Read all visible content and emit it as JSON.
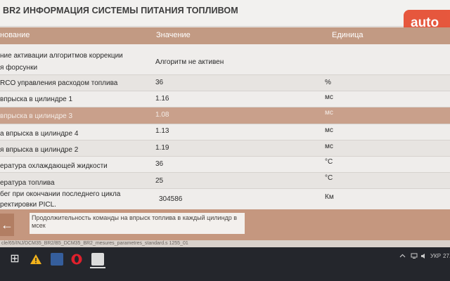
{
  "window": {
    "title": "BR2 ИНФОРМАЦИЯ СИСТЕМЫ ПИТАНИЯ ТОПЛИВОМ",
    "watermark": "auto"
  },
  "table": {
    "headers": {
      "name": "нование",
      "value": "Значение",
      "unit": "Единица"
    },
    "rows": [
      {
        "name_lines": [
          "ние активации алгоритмов коррекции",
          "я форсунки"
        ],
        "value": "Алгоритм не активен",
        "unit": ""
      },
      {
        "name_lines": [
          "RCO управления расходом топлива"
        ],
        "value": "36",
        "unit": "%"
      },
      {
        "name_lines": [
          "впрыска в цилиндре 1"
        ],
        "value": "1.16",
        "unit": "мс"
      },
      {
        "name_lines": [
          "впрыска в цилиндре 3"
        ],
        "value": "1.08",
        "unit": "мс"
      },
      {
        "name_lines": [
          "а впрыска в цилиндре 4"
        ],
        "value": "1.13",
        "unit": "мс"
      },
      {
        "name_lines": [
          "я впрыска в цилиндре 2"
        ],
        "value": "1.19",
        "unit": "мс"
      },
      {
        "name_lines": [
          "ература охлаждающей жидкости"
        ],
        "value": "36",
        "unit": "°C"
      },
      {
        "name_lines": [
          "ература топлива"
        ],
        "value": "25",
        "unit": "°C"
      },
      {
        "name_lines": [
          "бег при окончании последнего цикла",
          "ректировки PICL."
        ],
        "value": "304586",
        "unit": "Км"
      }
    ]
  },
  "info": {
    "back_icon": "←",
    "text": "Продолжительность команды на впрыск топлива в каждый цилиндр в мсек"
  },
  "status": {
    "path": "cle/65/INJ/DCM35_BR2/B5_DCM35_BR2_mesures_parametres_standard.s   1255_01"
  },
  "taskbar": {
    "start_icon": "⊞",
    "lang": "УКР",
    "clock": "27."
  },
  "colors": {
    "header": "#c29a83",
    "selected_row": "#c9a08b",
    "info_bar": "#c5977f",
    "watermark": "#e64a2e"
  }
}
